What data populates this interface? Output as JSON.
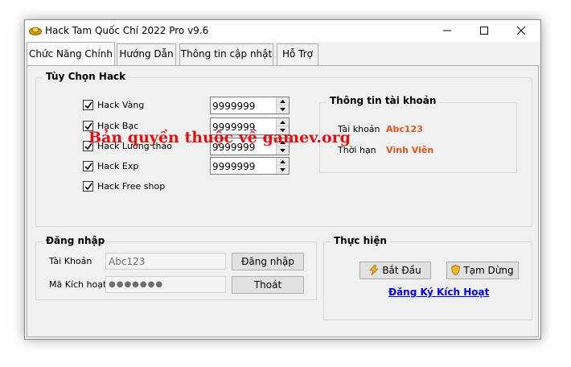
{
  "window": {
    "title": "Hack Tam Quốc Chí 2022 Pro v9.6"
  },
  "tabs": [
    {
      "label": "Chức Năng Chính",
      "active": true
    },
    {
      "label": "Hướng Dẫn",
      "active": false
    },
    {
      "label": "Thông tin cập nhật",
      "active": false
    },
    {
      "label": "Hỗ Trợ",
      "active": false
    }
  ],
  "hack_options": {
    "title": "Tùy Chọn Hack",
    "items": [
      {
        "label": "Hack Vàng",
        "checked": true,
        "value": "9999999"
      },
      {
        "label": "Hack Bạc",
        "checked": true,
        "value": "9999999"
      },
      {
        "label": "Hack Lương thảo",
        "checked": true,
        "value": "9999999"
      },
      {
        "label": "Hack Exp",
        "checked": true,
        "value": "9999999"
      },
      {
        "label": "Hack Free shop",
        "checked": true
      }
    ]
  },
  "account_info": {
    "title": "Thông tin tài khoản",
    "account_label": "Tài khoản",
    "account_value": "Abc123",
    "duration_label": "Thời hạn",
    "duration_value": "Vĩnh Viễn"
  },
  "login": {
    "title": "Đăng nhập",
    "account_label": "Tài Khoản",
    "account_value": "Abc123",
    "code_label": "Mã Kích hoạt",
    "code_value": "●●●●●●●",
    "login_button": "Đăng nhập",
    "exit_button": "Thoát"
  },
  "actions": {
    "title": "Thực hiện",
    "start_button": "Bắt Đầu",
    "pause_button": "Tạm Dừng",
    "register_link": "Đăng Ký Kích Hoạt"
  },
  "watermark": "Bản quyền thuộc về gamev.org",
  "colors": {
    "accent_orange": "#e8521c",
    "link_blue": "#0000ee",
    "watermark_red": "#e31010"
  }
}
